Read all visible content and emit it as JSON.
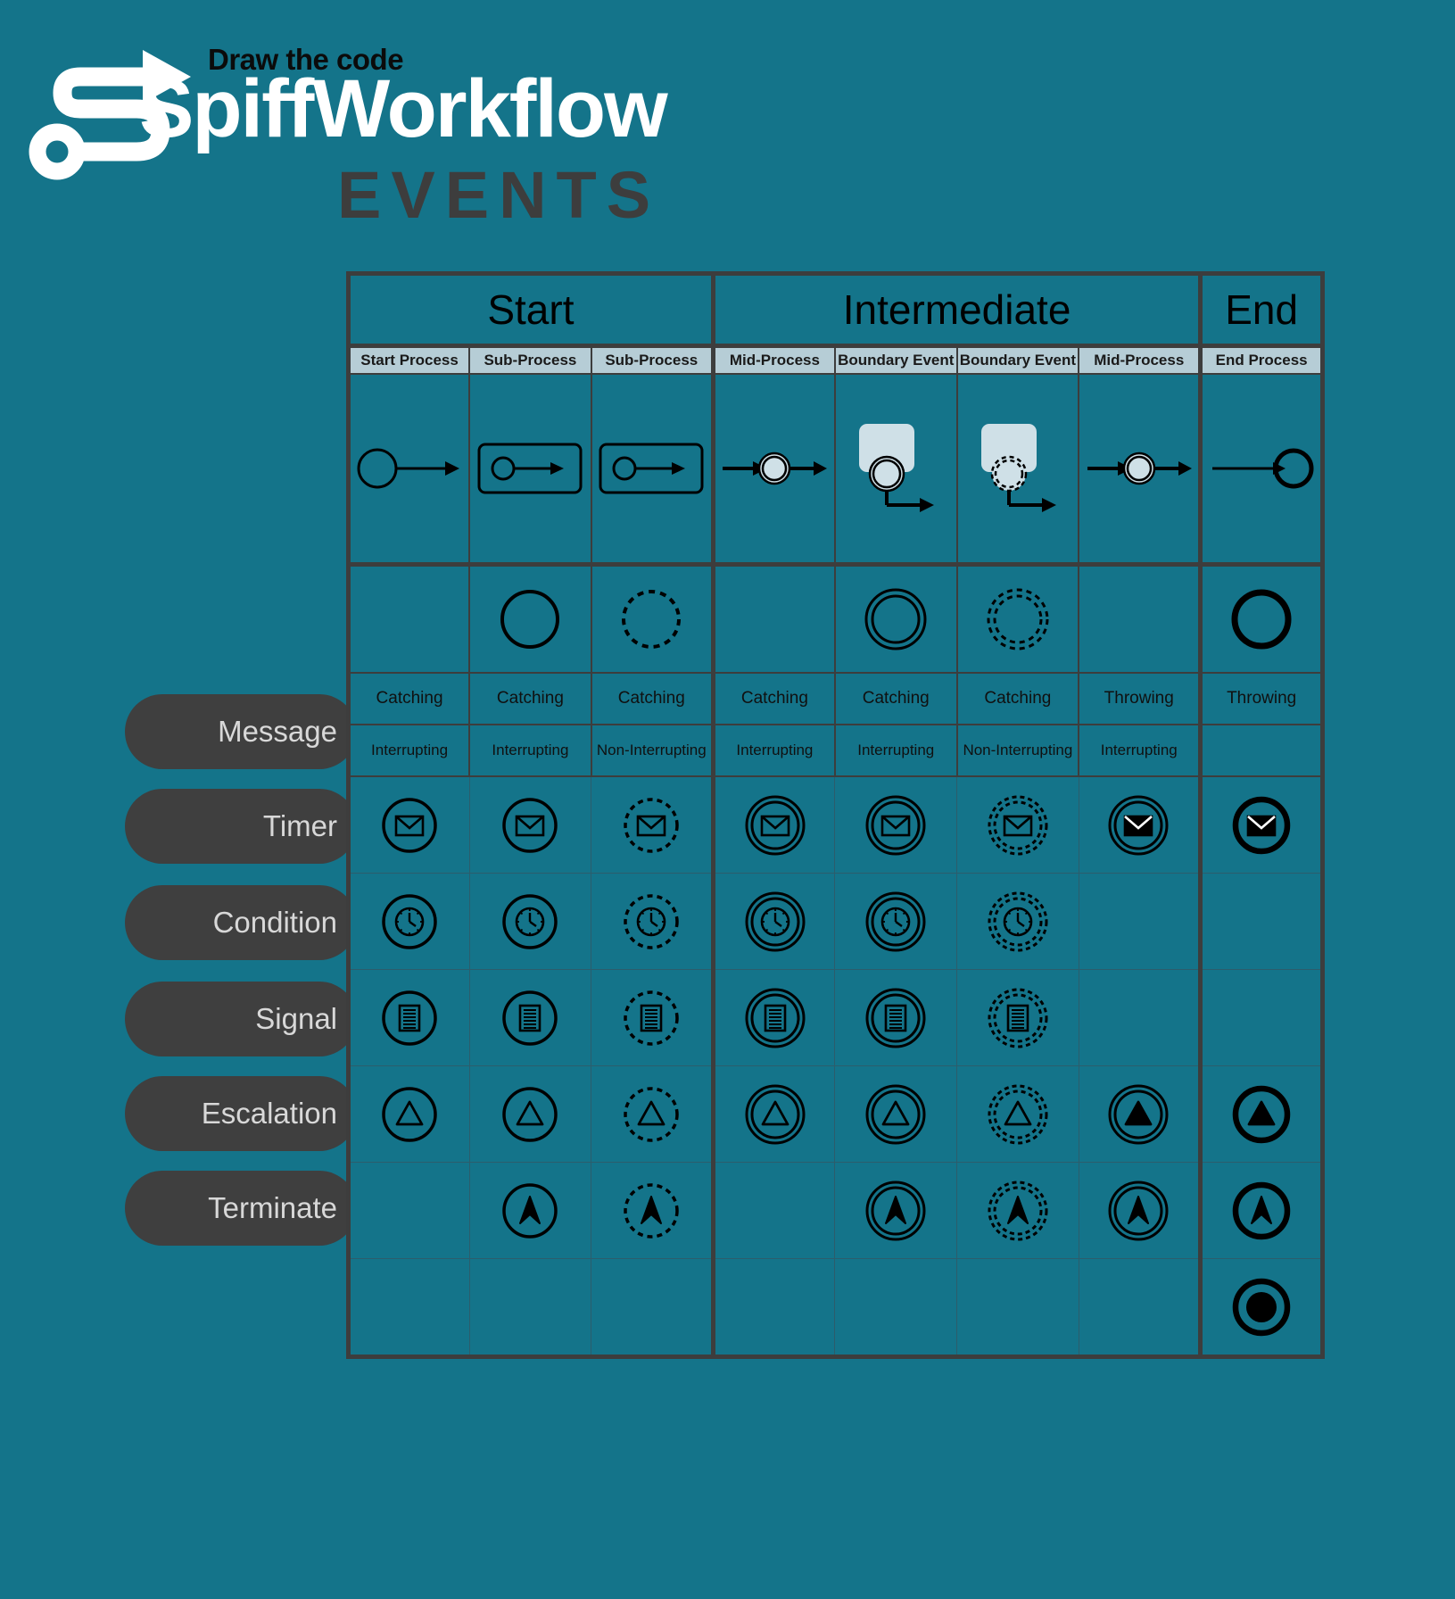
{
  "brand": {
    "tagline": "Draw the code",
    "wordmark": "SpiffWorkflow",
    "subtitle": "EVENTS",
    "logo_icon": "spiff-arrow-logo-icon",
    "bg_color": "#14748a",
    "dark_color": "#3d3d3d",
    "header_fill": "#b6cdd6"
  },
  "table": {
    "group_headers": [
      {
        "label": "Start",
        "span": 3
      },
      {
        "label": "Intermediate",
        "span": 4
      },
      {
        "label": "End",
        "span": 1
      }
    ],
    "sub_headers": [
      "Start Process",
      "Sub-Process",
      "Sub-Process",
      "Mid-Process",
      "Boundary Event",
      "Boundary Event",
      "Mid-Process",
      "End Process"
    ],
    "usage_diagrams": [
      "start-event-to-task",
      "subprocess-start-event",
      "subprocess-start-event",
      "mid-process-intermediate-event",
      "boundary-event-interrupting",
      "boundary-event-non-interrupting",
      "mid-process-throwing-event",
      "end-event"
    ],
    "ring_styles": [
      "",
      "single-solid-ring",
      "single-dashed-ring",
      "",
      "double-solid-ring",
      "double-dashed-ring",
      "",
      "thick-solid-ring"
    ],
    "catch_throw_row": [
      "Catching",
      "Catching",
      "Catching",
      "Catching",
      "Catching",
      "Catching",
      "Throwing",
      "Throwing"
    ],
    "interrupt_row": [
      "Interrupting",
      "Interrupting",
      "Non-Interrupting",
      "Interrupting",
      "Interrupting",
      "Non-Interrupting",
      "Interrupting",
      ""
    ],
    "event_rows": [
      {
        "label": "Message",
        "icon": "envelope-icon",
        "cells": [
          "single-solid",
          "single-solid",
          "single-dashed",
          "double-solid",
          "double-solid",
          "double-dashed",
          "throw-double-solid",
          "throw-thick-solid"
        ]
      },
      {
        "label": "Timer",
        "icon": "clock-icon",
        "cells": [
          "single-solid",
          "single-solid",
          "single-dashed",
          "double-solid",
          "double-solid",
          "double-dashed",
          "",
          ""
        ]
      },
      {
        "label": "Condition",
        "icon": "document-lines-icon",
        "cells": [
          "single-solid",
          "single-solid",
          "single-dashed",
          "double-solid",
          "double-solid",
          "double-dashed",
          "",
          ""
        ]
      },
      {
        "label": "Signal",
        "icon": "triangle-icon",
        "cells": [
          "single-solid",
          "single-solid",
          "single-dashed",
          "double-solid",
          "double-solid",
          "double-dashed",
          "throw-double-solid",
          "throw-thick-solid"
        ]
      },
      {
        "label": "Escalation",
        "icon": "chevron-up-icon",
        "cells": [
          "",
          "single-solid",
          "single-dashed",
          "",
          "double-solid",
          "double-dashed",
          "throw-double-solid",
          "throw-thick-solid"
        ]
      },
      {
        "label": "Terminate",
        "icon": "filled-circle-icon",
        "cells": [
          "",
          "",
          "",
          "",
          "",
          "",
          "",
          "throw-thick-solid"
        ]
      }
    ]
  }
}
